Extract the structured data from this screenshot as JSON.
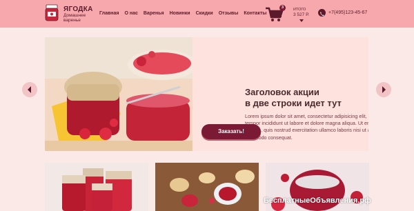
{
  "header": {
    "logo_title": "ЯГОДКА",
    "logo_subtitle": "Домашнее варенье",
    "nav": [
      "Главная",
      "О нас",
      "Варенья",
      "Новинки",
      "Скидки",
      "Отзывы",
      "Контакты"
    ],
    "cart": {
      "count": "3",
      "total_label": "ИТОГО",
      "total_value": "3 527 Р."
    },
    "phone": "+7(495)123-45-67"
  },
  "promo": {
    "title": "Заголовок акции\nв две строки идет тут",
    "text": "Lorem ipsum dolor sit amet, consectetur adipisicing elit, sed do eiusmod tempor incididunt ut labore et dolore magna aliqua. Ut enim ad minim veniam, quis nostrud exercitation ullamco laboris nisi ut aliquip ex ea commodo consequat.",
    "button_label": "Заказать!"
  },
  "watermark": "БесплатныеОбъявления.рф",
  "colors": {
    "header": "#f7a8ac",
    "accent": "#7a1a35",
    "background": "#fbe9e7"
  }
}
